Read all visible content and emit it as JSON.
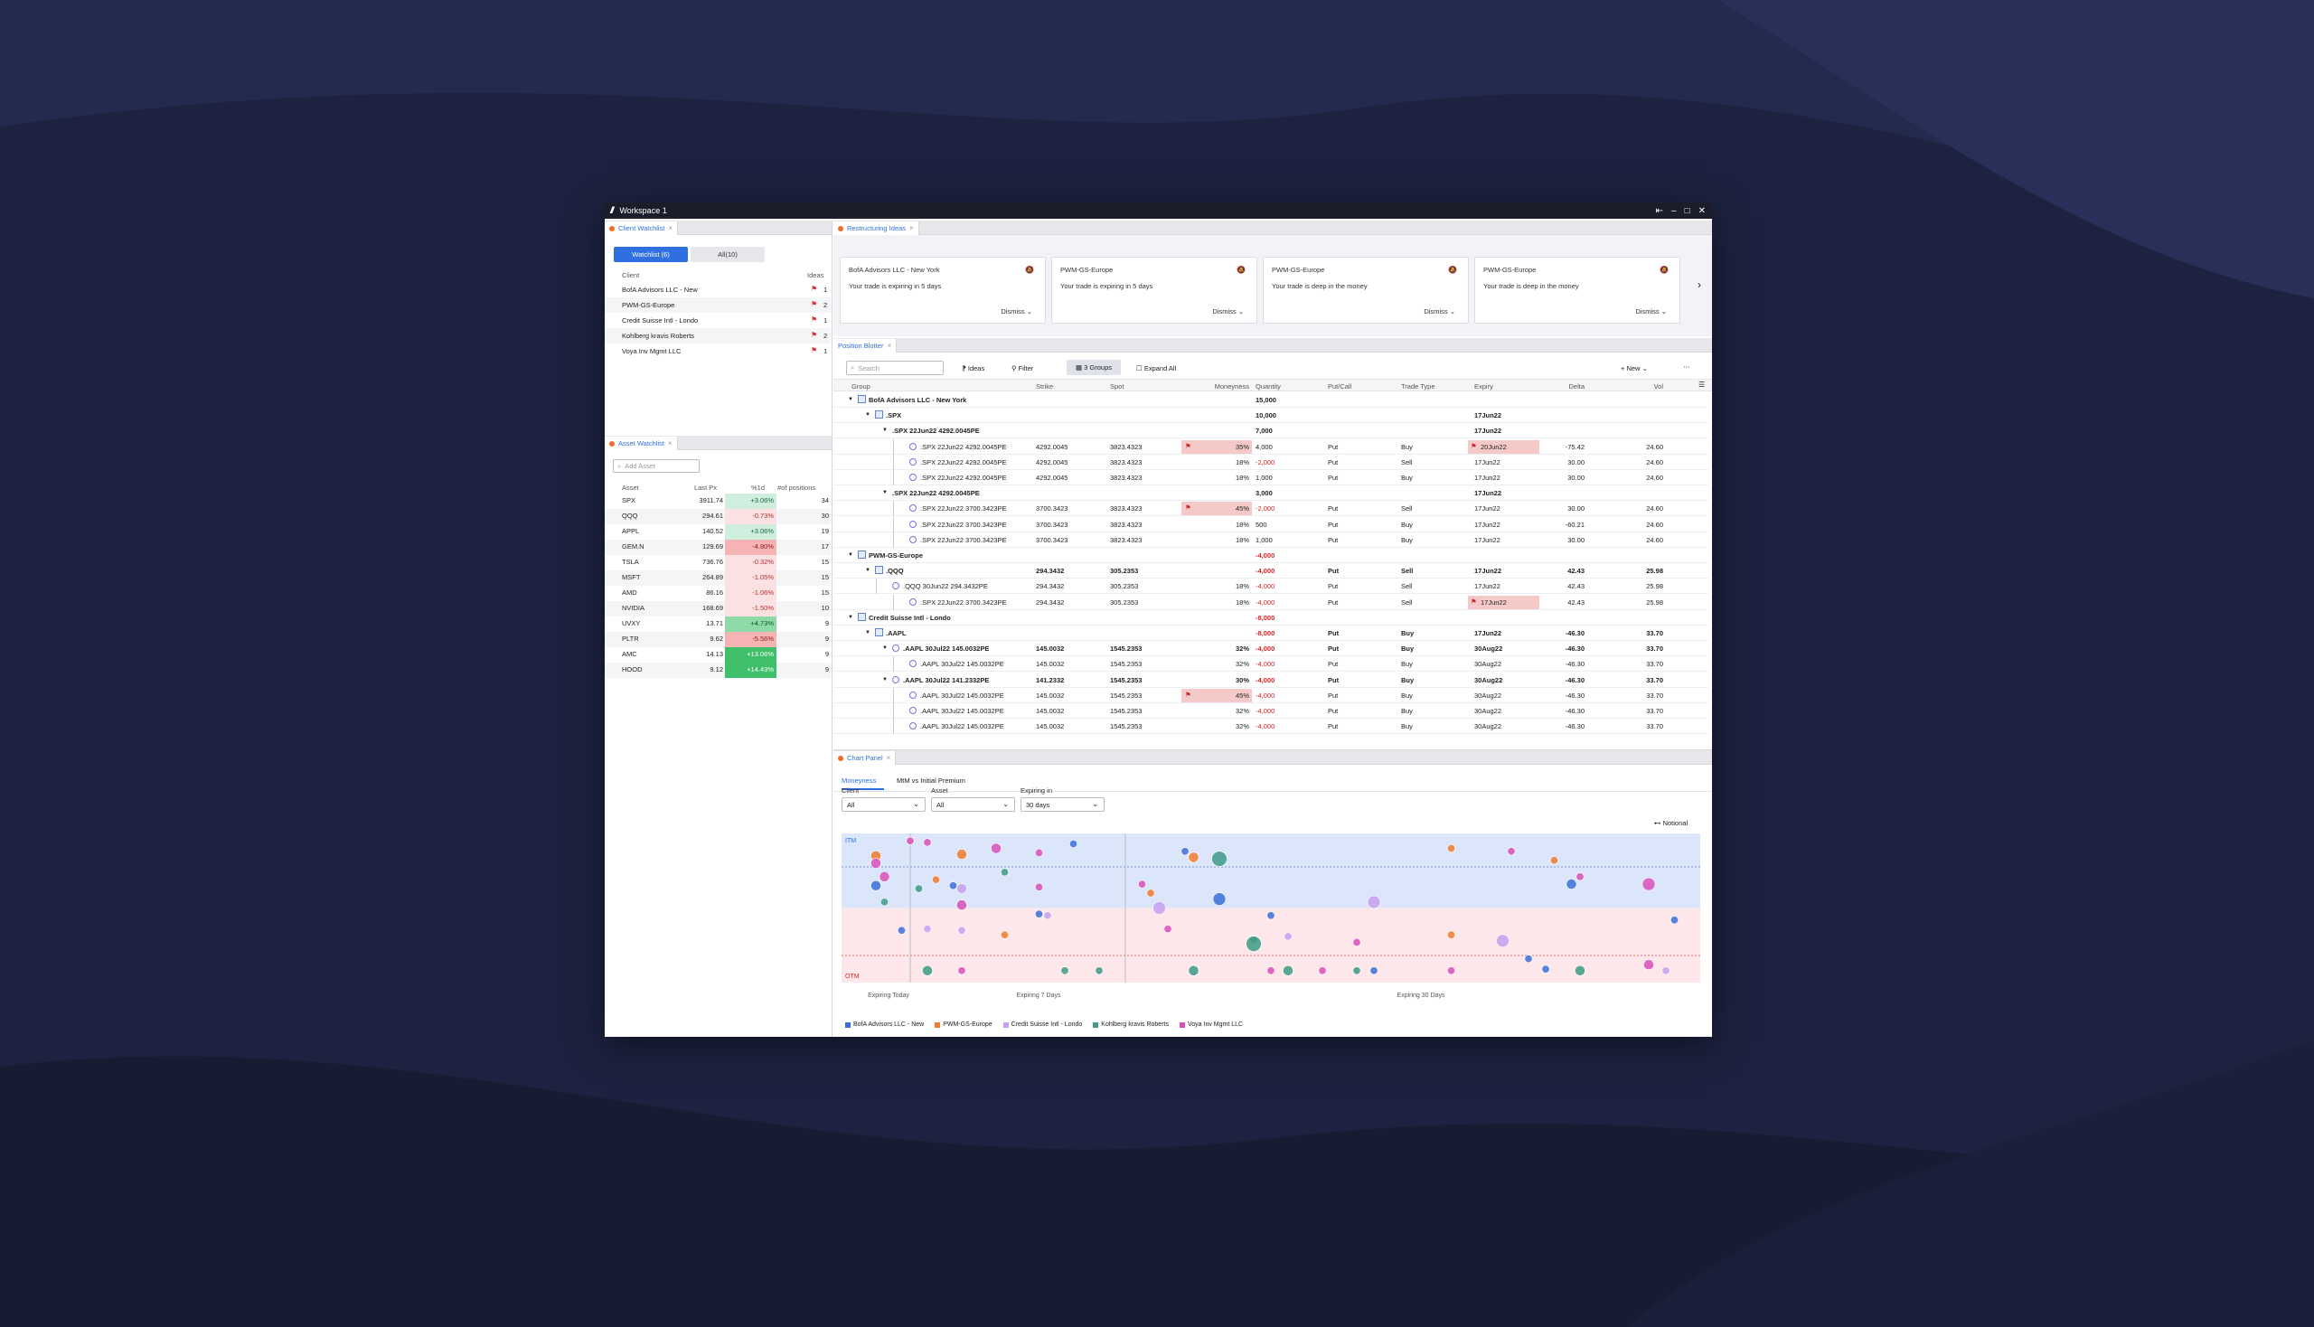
{
  "window": {
    "title": "Workspace 1",
    "controls": [
      "⇤",
      "–",
      "□",
      "✕"
    ]
  },
  "client_watchlist": {
    "tab": "Client Watchlist",
    "buttons": [
      "Watchlist (6)",
      "All(10)"
    ],
    "headers": {
      "client": "Client",
      "ideas": "Ideas"
    },
    "rows": [
      {
        "client": "BofA Advisors LLC - New",
        "ideas": "1"
      },
      {
        "client": "PWM-GS-Europe",
        "ideas": "2"
      },
      {
        "client": "Credit Suisse Intl - Londo",
        "ideas": "1"
      },
      {
        "client": "Kohlberg kravis Roberts",
        "ideas": "2"
      },
      {
        "client": "Voya Inv Mgmt LLC",
        "ideas": "1"
      }
    ]
  },
  "asset_watchlist": {
    "tab": "Asset Watchlist",
    "placeholder": "Add Asset",
    "headers": {
      "asset": "Asset",
      "last": "Last Px",
      "pct": "%1d",
      "pos": "#of positions"
    },
    "rows": [
      {
        "asset": "SPX",
        "last": "3911.74",
        "pct": "+3.06%",
        "pos": "34",
        "tone": "g1"
      },
      {
        "asset": "QQQ",
        "last": "294.61",
        "pct": "-0.73%",
        "pos": "30",
        "tone": "r1"
      },
      {
        "asset": "APPL",
        "last": "140.52",
        "pct": "+3.06%",
        "pos": "19",
        "tone": "g1"
      },
      {
        "asset": "GEM.N",
        "last": "129.69",
        "pct": "-4.80%",
        "pos": "17",
        "tone": "r2"
      },
      {
        "asset": "TSLA",
        "last": "736.76",
        "pct": "-0.32%",
        "pos": "15",
        "tone": "r1"
      },
      {
        "asset": "MSFT",
        "last": "264.89",
        "pct": "-1.05%",
        "pos": "15",
        "tone": "r1"
      },
      {
        "asset": "AMD",
        "last": "86.16",
        "pct": "-1.06%",
        "pos": "15",
        "tone": "r1"
      },
      {
        "asset": "NVIDIA",
        "last": "168.69",
        "pct": "-1.50%",
        "pos": "10",
        "tone": "r1"
      },
      {
        "asset": "UVXY",
        "last": "13.71",
        "pct": "+4.73%",
        "pos": "9",
        "tone": "g2"
      },
      {
        "asset": "PLTR",
        "last": "9.62",
        "pct": "-5.56%",
        "pos": "9",
        "tone": "r2"
      },
      {
        "asset": "AMC",
        "last": "14.13",
        "pct": "+13.06%",
        "pos": "9",
        "tone": "g3"
      },
      {
        "asset": "HOOD",
        "last": "9.12",
        "pct": "+14.43%",
        "pos": "9",
        "tone": "g3"
      }
    ]
  },
  "restructuring": {
    "tab": "Restructuring Ideas",
    "cards": [
      {
        "client": "BofA Advisors LLC - New York",
        "msg": "Your trade is expiring in 5 days",
        "action": "Dismiss"
      },
      {
        "client": "PWM-GS-Europe",
        "msg": "Your trade is expiring in 5 days",
        "action": "Dismiss"
      },
      {
        "client": "PWM-GS-Europe",
        "msg": "Your trade is deep in the money",
        "action": "Dismiss"
      },
      {
        "client": "PWM-GS-Europe",
        "msg": "Your trade is deep in the money",
        "action": "Dismiss"
      }
    ]
  },
  "blotter": {
    "tab": "Position Blotter",
    "search_placeholder": "Search",
    "toolbar": {
      "ideas": "Ideas",
      "filter": "Filter",
      "groups": "3 Groups",
      "expand": "Expand All",
      "new": "New"
    },
    "headers": {
      "group": "Group",
      "strike": "Strike",
      "spot": "Spot",
      "moneyness": "Moneyness",
      "quantity": "Quantity",
      "putcall": "Put/Call",
      "tradetype": "Trade Type",
      "expiry": "Expiry",
      "delta": "Delta",
      "vol": "Vol"
    },
    "rows": [
      {
        "lvl": 0,
        "icon": "group",
        "label": "BofA Advisors LLC - New York",
        "quantity": "15,000",
        "bold": true
      },
      {
        "lvl": 1,
        "icon": "asset",
        "label": ".SPX",
        "quantity": "10,000",
        "expiry": "17Jun22",
        "bold": true
      },
      {
        "lvl": 2,
        "icon": "",
        "label": ".SPX 22Jun22 4292.0045PE",
        "quantity": "7,000",
        "expiry": "17Jun22",
        "bold": true
      },
      {
        "lvl": 3,
        "icon": "leaf",
        "label": ".SPX 22Jun22 4292.0045PE",
        "strike": "4292.0045",
        "spot": "3823.4323",
        "moneyness": "35%",
        "mflag": true,
        "quantity": "4,000",
        "putcall": "Put",
        "tradetype": "Buy",
        "expiry": "20Jun22",
        "eflag": true,
        "delta": "-75.42",
        "vol": "24.60"
      },
      {
        "lvl": 3,
        "icon": "leaf",
        "label": ".SPX 22Jun22 4292.0045PE",
        "strike": "4292.0045",
        "spot": "3823.4323",
        "moneyness": "18%",
        "quantity": "-2,000",
        "neg": true,
        "putcall": "Put",
        "tradetype": "Sell",
        "expiry": "17Jun22",
        "delta": "30.00",
        "vol": "24.60"
      },
      {
        "lvl": 3,
        "icon": "leaf",
        "label": ".SPX 22Jun22 4292.0045PE",
        "strike": "4292.0045",
        "spot": "3823.4323",
        "moneyness": "18%",
        "quantity": "1,000",
        "putcall": "Put",
        "tradetype": "Buy",
        "expiry": "17Jun22",
        "delta": "30.00",
        "vol": "24.60"
      },
      {
        "lvl": 2,
        "icon": "",
        "label": ".SPX 22Jun22 4292.0045PE",
        "quantity": "3,000",
        "expiry": "17Jun22",
        "bold": true
      },
      {
        "lvl": 3,
        "icon": "leaf",
        "label": ".SPX 22Jun22 3700.3423PE",
        "strike": "3700.3423",
        "spot": "3823.4323",
        "moneyness": "45%",
        "mflag": true,
        "quantity": "-2,000",
        "neg": true,
        "putcall": "Put",
        "tradetype": "Sell",
        "expiry": "17Jun22",
        "delta": "30.00",
        "vol": "24.60"
      },
      {
        "lvl": 3,
        "icon": "leaf",
        "label": ".SPX 22Jun22 3700.3423PE",
        "strike": "3700.3423",
        "spot": "3823.4323",
        "moneyness": "18%",
        "quantity": "500",
        "putcall": "Put",
        "tradetype": "Buy",
        "expiry": "17Jun22",
        "delta": "-60.21",
        "vol": "24.60"
      },
      {
        "lvl": 3,
        "icon": "leaf",
        "label": ".SPX 22Jun22 3700.3423PE",
        "strike": "3700.3423",
        "spot": "3823.4323",
        "moneyness": "18%",
        "quantity": "1,000",
        "putcall": "Put",
        "tradetype": "Buy",
        "expiry": "17Jun22",
        "delta": "30.00",
        "vol": "24.60"
      },
      {
        "lvl": 0,
        "icon": "group",
        "label": "PWM-GS-Europe",
        "quantity": "-4,000",
        "neg": true,
        "bold": true
      },
      {
        "lvl": 1,
        "icon": "asset",
        "label": ".QQQ",
        "strike": "294.3432",
        "spot": "305.2353",
        "quantity": "-4,000",
        "neg": true,
        "putcall": "Put",
        "tradetype": "Sell",
        "expiry": "17Jun22",
        "delta": "42.43",
        "vol": "25.98",
        "bold": true
      },
      {
        "lvl": 2,
        "icon": "leaf",
        "label": ".QQQ 30Jun22 294.3432PE",
        "strike": "294.3432",
        "spot": "305.2353",
        "moneyness": "18%",
        "quantity": "-4,000",
        "neg": true,
        "putcall": "Put",
        "tradetype": "Sell",
        "expiry": "17Jun22",
        "delta": "42.43",
        "vol": "25.98"
      },
      {
        "lvl": 3,
        "icon": "leaf",
        "label": ".SPX 22Jun22 3700.3423PE",
        "strike": "294.3432",
        "spot": "305.2353",
        "moneyness": "18%",
        "quantity": "-4,000",
        "neg": true,
        "putcall": "Put",
        "tradetype": "Sell",
        "expiry": "17Jun22",
        "eflag": true,
        "delta": "42.43",
        "vol": "25.98"
      },
      {
        "lvl": 0,
        "icon": "group",
        "label": "Credit Suisse Intl - Londo",
        "quantity": "-8,000",
        "neg": true,
        "bold": true
      },
      {
        "lvl": 1,
        "icon": "asset",
        "label": ".AAPL",
        "quantity": "-8,000",
        "neg": true,
        "putcall": "Put",
        "tradetype": "Buy",
        "expiry": "17Jun22",
        "delta": "-46.30",
        "vol": "33.70",
        "bold": true
      },
      {
        "lvl": 2,
        "icon": "leaf",
        "label": ".AAPL 30Jul22 145.0032PE",
        "strike": "145.0032",
        "spot": "1545.2353",
        "moneyness": "32%",
        "quantity": "-4,000",
        "neg": true,
        "putcall": "Put",
        "tradetype": "Buy",
        "expiry": "30Aug22",
        "delta": "-46.30",
        "vol": "33.70",
        "bold": true
      },
      {
        "lvl": 3,
        "icon": "leaf",
        "label": ".AAPL 30Jul22 145.0032PE",
        "strike": "145.0032",
        "spot": "1545.2353",
        "moneyness": "32%",
        "quantity": "-4,000",
        "neg": true,
        "putcall": "Put",
        "tradetype": "Buy",
        "expiry": "30Aug22",
        "delta": "-46.30",
        "vol": "33.70"
      },
      {
        "lvl": 2,
        "icon": "leaf",
        "label": ".AAPL 30Jul22 141.2332PE",
        "strike": "141.2332",
        "spot": "1545.2353",
        "moneyness": "30%",
        "quantity": "-4,000",
        "neg": true,
        "putcall": "Put",
        "tradetype": "Buy",
        "expiry": "30Aug22",
        "delta": "-46.30",
        "vol": "33.70",
        "bold": true
      },
      {
        "lvl": 3,
        "icon": "leaf",
        "label": ".AAPL 30Jul22 145.0032PE",
        "strike": "145.0032",
        "spot": "1545.2353",
        "moneyness": "45%",
        "mflag": true,
        "quantity": "-4,000",
        "neg": true,
        "putcall": "Put",
        "tradetype": "Buy",
        "expiry": "30Aug22",
        "delta": "-46.30",
        "vol": "33.70"
      },
      {
        "lvl": 3,
        "icon": "leaf",
        "label": ".AAPL 30Jul22 145.0032PE",
        "strike": "145.0032",
        "spot": "1545.2353",
        "moneyness": "32%",
        "quantity": "-4,000",
        "neg": true,
        "putcall": "Put",
        "tradetype": "Buy",
        "expiry": "30Aug22",
        "delta": "-46.30",
        "vol": "33.70"
      },
      {
        "lvl": 3,
        "icon": "leaf",
        "label": ".AAPL 30Jul22 145.0032PE",
        "strike": "145.0032",
        "spot": "1545.2353",
        "moneyness": "32%",
        "quantity": "-4,000",
        "neg": true,
        "putcall": "Put",
        "tradetype": "Buy",
        "expiry": "30Aug22",
        "delta": "-46.30",
        "vol": "33.70"
      }
    ]
  },
  "chart_panel": {
    "tab": "Chart Panel",
    "subtabs": [
      "Moneyness",
      "MtM vs Initial Premium"
    ],
    "filters": [
      {
        "label": "Client",
        "value": "All"
      },
      {
        "label": "Asset",
        "value": "All"
      },
      {
        "label": "Expiring in",
        "value": "30 days"
      }
    ],
    "notional": "Notional",
    "colors": {
      "BofA": "#3b6fd8",
      "PWM": "#f07a30",
      "CS": "#c6a0ee",
      "KKR": "#3d9a86",
      "Voya": "#d94fb8"
    }
  },
  "chart_data": {
    "type": "scatter",
    "regions": [
      "ITM",
      "OTM"
    ],
    "bands": [
      "Expiring Today",
      "Expiring 7 Days",
      "Expiring 30 Days"
    ],
    "legend": [
      "BofA Advisors LLC - New",
      "PWM-GS-Europe",
      "Credit Suisse Intl - Londo",
      "Kohlberg kravis Roberts",
      "Voya Inv Mgmt LLC"
    ],
    "series": [
      {
        "name": "BofA Advisors LLC - New",
        "color": "#3b6fd8",
        "points": [
          [
            0.04,
            0.35,
            4
          ],
          [
            0.13,
            0.35,
            3
          ],
          [
            0.23,
            0.54,
            3
          ],
          [
            0.27,
            0.07,
            3
          ],
          [
            0.4,
            0.12,
            3
          ],
          [
            0.44,
            0.44,
            5
          ],
          [
            0.5,
            0.55,
            3
          ],
          [
            0.62,
            0.92,
            3
          ],
          [
            0.8,
            0.84,
            3
          ],
          [
            0.82,
            0.91,
            3
          ],
          [
            0.97,
            0.58,
            3
          ],
          [
            0.85,
            0.34,
            4
          ],
          [
            0.07,
            0.65,
            3
          ]
        ]
      },
      {
        "name": "PWM-GS-Europe",
        "color": "#f07a30",
        "points": [
          [
            0.04,
            0.15,
            4
          ],
          [
            0.14,
            0.14,
            4
          ],
          [
            0.19,
            0.68,
            3
          ],
          [
            0.11,
            0.31,
            3
          ],
          [
            0.36,
            0.4,
            3
          ],
          [
            0.41,
            0.16,
            4
          ],
          [
            0.71,
            0.1,
            3
          ],
          [
            0.71,
            0.68,
            3
          ],
          [
            0.83,
            0.18,
            3
          ]
        ]
      },
      {
        "name": "Credit Suisse Intl - Londo",
        "color": "#c6a0ee",
        "points": [
          [
            0.1,
            0.64,
            3
          ],
          [
            0.14,
            0.37,
            4
          ],
          [
            0.14,
            0.65,
            3
          ],
          [
            0.24,
            0.55,
            3
          ],
          [
            0.37,
            0.5,
            5
          ],
          [
            0.52,
            0.69,
            3
          ],
          [
            0.62,
            0.46,
            5
          ],
          [
            0.77,
            0.72,
            5
          ],
          [
            0.96,
            0.92,
            3
          ]
        ]
      },
      {
        "name": "Kohlberg kravis Roberts",
        "color": "#3d9a86",
        "points": [
          [
            0.05,
            0.46,
            3
          ],
          [
            0.1,
            0.92,
            4
          ],
          [
            0.19,
            0.26,
            3
          ],
          [
            0.26,
            0.92,
            3
          ],
          [
            0.3,
            0.92,
            3
          ],
          [
            0.41,
            0.92,
            4
          ],
          [
            0.48,
            0.71,
            3
          ],
          [
            0.52,
            0.92,
            4
          ],
          [
            0.6,
            0.92,
            3
          ],
          [
            0.86,
            0.92,
            4
          ],
          [
            0.09,
            0.37,
            3
          ],
          [
            0.44,
            0.17,
            6
          ],
          [
            0.48,
            0.74,
            6
          ]
        ]
      },
      {
        "name": "Voya Inv Mgmt LLC",
        "color": "#d94fb8",
        "points": [
          [
            0.05,
            0.29,
            4
          ],
          [
            0.1,
            0.06,
            3
          ],
          [
            0.14,
            0.48,
            4
          ],
          [
            0.14,
            0.92,
            3
          ],
          [
            0.18,
            0.1,
            4
          ],
          [
            0.23,
            0.13,
            3
          ],
          [
            0.23,
            0.36,
            3
          ],
          [
            0.35,
            0.34,
            3
          ],
          [
            0.38,
            0.64,
            3
          ],
          [
            0.5,
            0.92,
            3
          ],
          [
            0.56,
            0.92,
            3
          ],
          [
            0.6,
            0.73,
            3
          ],
          [
            0.71,
            0.92,
            3
          ],
          [
            0.78,
            0.12,
            3
          ],
          [
            0.86,
            0.29,
            3
          ],
          [
            0.94,
            0.88,
            4
          ],
          [
            0.08,
            0.05,
            3
          ],
          [
            0.04,
            0.2,
            4
          ],
          [
            0.94,
            0.34,
            5
          ]
        ]
      }
    ]
  }
}
